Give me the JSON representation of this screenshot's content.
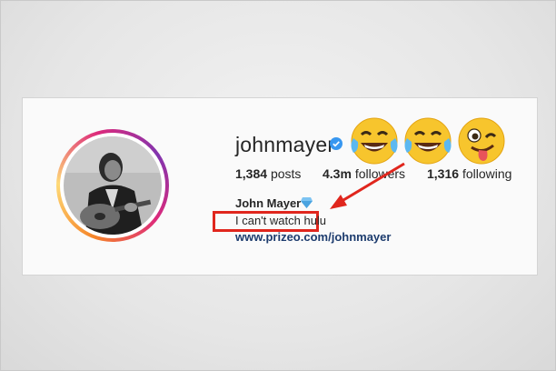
{
  "profile": {
    "username": "johnmayer",
    "stats": {
      "posts_count": "1,384",
      "posts_label": "posts",
      "followers_count": "4.3m",
      "followers_label": "followers",
      "following_count": "1,316",
      "following_label": "following"
    },
    "full_name": "John Mayer",
    "bio": "I can't watch hulu",
    "link": "www.prizeo.com/johnmayer"
  },
  "annotations": {
    "emojis": [
      "face-with-tears-of-joy",
      "face-with-tears-of-joy",
      "winking-face-with-tongue"
    ],
    "highlight_color": "#e0261d"
  },
  "colors": {
    "verified_badge": "#3897f0",
    "link": "#1d3c6e"
  }
}
